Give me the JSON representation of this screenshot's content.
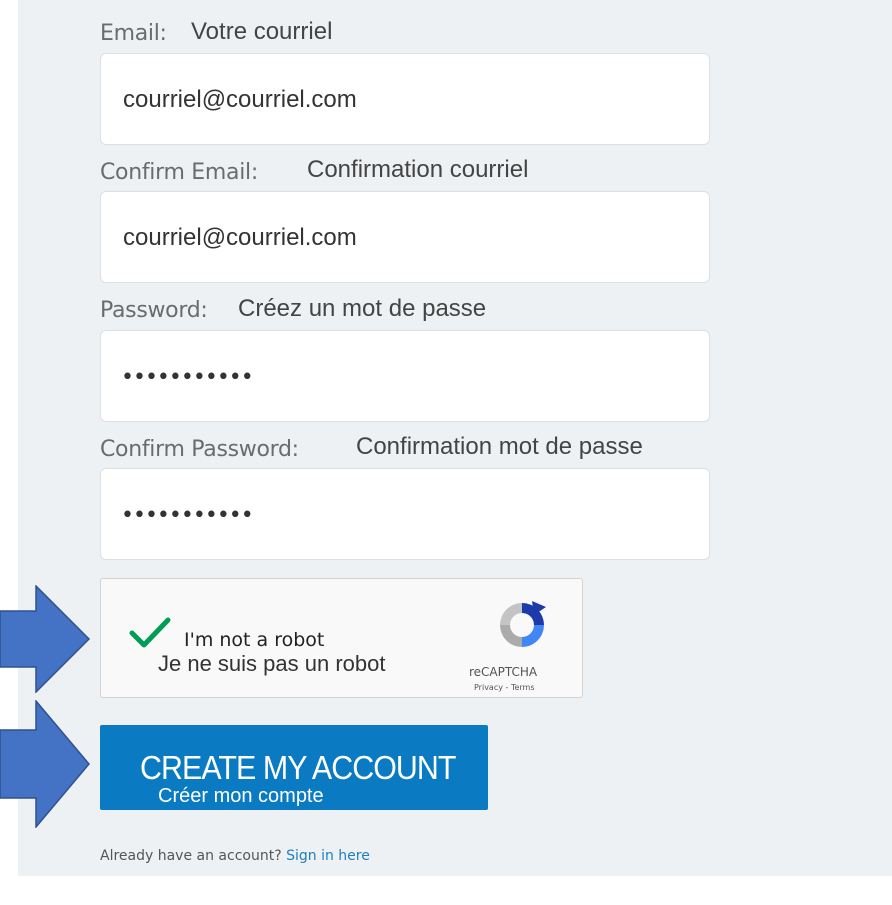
{
  "form": {
    "email": {
      "label": "Email:",
      "translation": "Votre courriel",
      "value": "courriel@courriel.com"
    },
    "confirm_email": {
      "label": "Confirm Email:",
      "translation": "Confirmation courriel",
      "value": "courriel@courriel.com"
    },
    "password": {
      "label": "Password:",
      "translation": "Créez un mot de passe",
      "masked_value": "•••••••••••"
    },
    "confirm_password": {
      "label": "Confirm Password:",
      "translation": "Confirmation mot de passe",
      "masked_value": "•••••••••••"
    }
  },
  "captcha": {
    "checked": true,
    "label": "I'm not a robot",
    "translation": "Je ne suis pas un robot",
    "brand": "reCAPTCHA",
    "links": "Privacy - Terms"
  },
  "submit": {
    "label": "CREATE MY ACCOUNT",
    "translation": "Créer mon compte"
  },
  "footer": {
    "text": "Already have an account?",
    "link": "Sign in here"
  },
  "colors": {
    "accent": "#0a7bc2",
    "annotation_arrow": "#4472c4",
    "checkmark": "#009e55",
    "panel_bg": "#eef1f4"
  },
  "icons": [
    "checkmark-icon",
    "recaptcha-logo-icon",
    "pointer-arrow-icon"
  ]
}
